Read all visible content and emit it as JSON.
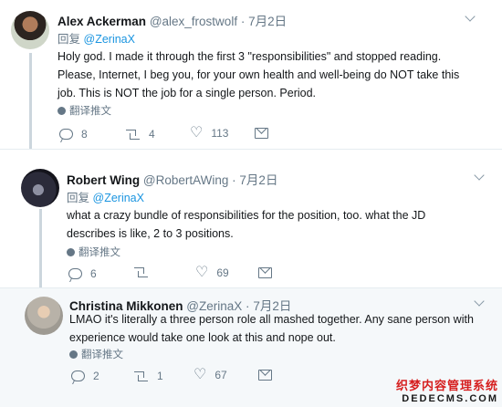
{
  "tweets": [
    {
      "name": "Alex Ackerman",
      "handle": "@alex_frostwolf",
      "separator": "·",
      "date": "7月2日",
      "reply_prefix": "回复",
      "reply_to": "@ZerinaX",
      "lines": [
        "Holy god. I made it through the first 3 \"responsibilities\" and stopped reading.",
        "Please, Internet, I beg you, for your own health and well-being do NOT take this",
        "job. This is NOT the job for a single person. Period."
      ],
      "translate_label": "翻译推文",
      "replies": "8",
      "retweets": "4",
      "likes": "113"
    },
    {
      "name": "Robert Wing",
      "handle": "@RobertAWing",
      "separator": "·",
      "date": "7月2日",
      "reply_prefix": "回复",
      "reply_to": "@ZerinaX",
      "lines": [
        "what a crazy bundle of responsibilities for the position, too. what the JD",
        "describes is like, 2 to 3 positions."
      ],
      "translate_label": "翻译推文",
      "replies": "6",
      "retweets": "",
      "likes": "69"
    },
    {
      "name": "Christina Mikkonen",
      "handle": "@ZerinaX",
      "separator": "·",
      "date": "7月2日",
      "lines": [
        "LMAO it's literally a three person role all mashed together. Any sane person with",
        "experience would take one look at this and nope out."
      ],
      "translate_label": "翻译推文",
      "replies": "2",
      "retweets": "1",
      "likes": "67"
    }
  ],
  "watermark": {
    "line1": "织梦内容管理系统",
    "line2": "DEDECMS.COM"
  },
  "colors": {
    "link": "#1b95e0",
    "muted": "#657786",
    "thread_line": "#ccd6dd",
    "highlight_bg": "#f5f8fa"
  }
}
